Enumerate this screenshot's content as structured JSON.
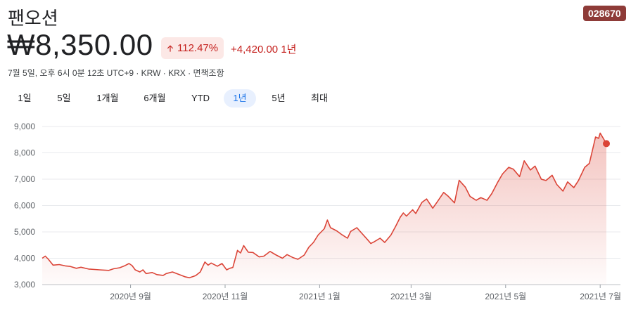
{
  "header": {
    "title": "팬오션",
    "ticker": "028670",
    "price": "₩8,350.00",
    "percent_change": "112.47%",
    "abs_change": "+4,420.00 1년",
    "meta": "7월 5일, 오후 6시 0분 12초 UTC+9 · KRW · KRX · 면책조항",
    "colors": {
      "negative_accent": "#c5221f",
      "badge_bg": "#fce8e6",
      "ticker_bg": "#8e3b38",
      "tab_active": "#1a73e8"
    },
    "icons": {
      "change_direction": "arrow-up-icon"
    }
  },
  "tabs": [
    {
      "label": "1일",
      "active": false
    },
    {
      "label": "5일",
      "active": false
    },
    {
      "label": "1개월",
      "active": false
    },
    {
      "label": "6개월",
      "active": false
    },
    {
      "label": "YTD",
      "active": false
    },
    {
      "label": "1년",
      "active": true
    },
    {
      "label": "5년",
      "active": false
    },
    {
      "label": "최대",
      "active": false
    }
  ],
  "chart_data": {
    "type": "area",
    "line_color": "#db4437",
    "grid": true,
    "ylim": [
      3000,
      9000
    ],
    "y_ticks": [
      {
        "value": 9000,
        "label": "9,000"
      },
      {
        "value": 8000,
        "label": "8,000"
      },
      {
        "value": 7000,
        "label": "7,000"
      },
      {
        "value": 6000,
        "label": "6,000"
      },
      {
        "value": 5000,
        "label": "5,000"
      },
      {
        "value": 4000,
        "label": "4,000"
      },
      {
        "value": 3000,
        "label": "3,000"
      }
    ],
    "xlim": [
      "2020-07-06",
      "2021-07-05"
    ],
    "x_ticks": [
      {
        "date": "2020-09-01",
        "label": "2020년 9월"
      },
      {
        "date": "2020-11-01",
        "label": "2020년 11월"
      },
      {
        "date": "2021-01-01",
        "label": "2021년 1월"
      },
      {
        "date": "2021-03-01",
        "label": "2021년 3월"
      },
      {
        "date": "2021-05-01",
        "label": "2021년 5월"
      },
      {
        "date": "2021-07-01",
        "label": "2021년 7월"
      }
    ],
    "series": [
      {
        "points": [
          [
            "2020-07-06",
            4000
          ],
          [
            "2020-07-08",
            4080
          ],
          [
            "2020-07-10",
            3960
          ],
          [
            "2020-07-13",
            3740
          ],
          [
            "2020-07-17",
            3760
          ],
          [
            "2020-07-21",
            3710
          ],
          [
            "2020-07-24",
            3690
          ],
          [
            "2020-07-28",
            3620
          ],
          [
            "2020-07-31",
            3660
          ],
          [
            "2020-08-05",
            3590
          ],
          [
            "2020-08-12",
            3560
          ],
          [
            "2020-08-18",
            3540
          ],
          [
            "2020-08-21",
            3600
          ],
          [
            "2020-08-25",
            3640
          ],
          [
            "2020-08-28",
            3710
          ],
          [
            "2020-08-31",
            3800
          ],
          [
            "2020-09-02",
            3720
          ],
          [
            "2020-09-04",
            3560
          ],
          [
            "2020-09-07",
            3480
          ],
          [
            "2020-09-09",
            3560
          ],
          [
            "2020-09-11",
            3420
          ],
          [
            "2020-09-15",
            3460
          ],
          [
            "2020-09-18",
            3380
          ],
          [
            "2020-09-22",
            3350
          ],
          [
            "2020-09-24",
            3420
          ],
          [
            "2020-09-28",
            3480
          ],
          [
            "2020-10-02",
            3390
          ],
          [
            "2020-10-06",
            3300
          ],
          [
            "2020-10-09",
            3260
          ],
          [
            "2020-10-13",
            3340
          ],
          [
            "2020-10-16",
            3480
          ],
          [
            "2020-10-19",
            3860
          ],
          [
            "2020-10-21",
            3740
          ],
          [
            "2020-10-23",
            3820
          ],
          [
            "2020-10-27",
            3700
          ],
          [
            "2020-10-30",
            3800
          ],
          [
            "2020-11-02",
            3560
          ],
          [
            "2020-11-04",
            3620
          ],
          [
            "2020-11-06",
            3650
          ],
          [
            "2020-11-09",
            4300
          ],
          [
            "2020-11-11",
            4200
          ],
          [
            "2020-11-13",
            4480
          ],
          [
            "2020-11-16",
            4230
          ],
          [
            "2020-11-19",
            4220
          ],
          [
            "2020-11-23",
            4050
          ],
          [
            "2020-11-26",
            4080
          ],
          [
            "2020-11-30",
            4260
          ],
          [
            "2020-12-04",
            4120
          ],
          [
            "2020-12-08",
            4000
          ],
          [
            "2020-12-11",
            4140
          ],
          [
            "2020-12-15",
            4020
          ],
          [
            "2020-12-18",
            3960
          ],
          [
            "2020-12-22",
            4120
          ],
          [
            "2020-12-25",
            4420
          ],
          [
            "2020-12-28",
            4600
          ],
          [
            "2020-12-31",
            4880
          ],
          [
            "2021-01-04",
            5120
          ],
          [
            "2021-01-06",
            5450
          ],
          [
            "2021-01-08",
            5160
          ],
          [
            "2021-01-12",
            5040
          ],
          [
            "2021-01-15",
            4910
          ],
          [
            "2021-01-19",
            4760
          ],
          [
            "2021-01-21",
            5020
          ],
          [
            "2021-01-25",
            5160
          ],
          [
            "2021-01-28",
            4960
          ],
          [
            "2021-02-01",
            4700
          ],
          [
            "2021-02-03",
            4560
          ],
          [
            "2021-02-05",
            4620
          ],
          [
            "2021-02-09",
            4760
          ],
          [
            "2021-02-12",
            4600
          ],
          [
            "2021-02-16",
            4880
          ],
          [
            "2021-02-19",
            5210
          ],
          [
            "2021-02-22",
            5560
          ],
          [
            "2021-02-24",
            5720
          ],
          [
            "2021-02-26",
            5600
          ],
          [
            "2021-03-02",
            5840
          ],
          [
            "2021-03-04",
            5700
          ],
          [
            "2021-03-08",
            6120
          ],
          [
            "2021-03-11",
            6250
          ],
          [
            "2021-03-15",
            5900
          ],
          [
            "2021-03-18",
            6150
          ],
          [
            "2021-03-22",
            6500
          ],
          [
            "2021-03-25",
            6350
          ],
          [
            "2021-03-29",
            6100
          ],
          [
            "2021-04-01",
            6960
          ],
          [
            "2021-04-05",
            6700
          ],
          [
            "2021-04-08",
            6350
          ],
          [
            "2021-04-12",
            6200
          ],
          [
            "2021-04-15",
            6300
          ],
          [
            "2021-04-19",
            6200
          ],
          [
            "2021-04-22",
            6450
          ],
          [
            "2021-04-26",
            6900
          ],
          [
            "2021-04-29",
            7200
          ],
          [
            "2021-05-03",
            7450
          ],
          [
            "2021-05-06",
            7380
          ],
          [
            "2021-05-10",
            7100
          ],
          [
            "2021-05-13",
            7700
          ],
          [
            "2021-05-17",
            7350
          ],
          [
            "2021-05-20",
            7500
          ],
          [
            "2021-05-24",
            7000
          ],
          [
            "2021-05-27",
            6950
          ],
          [
            "2021-05-31",
            7150
          ],
          [
            "2021-06-03",
            6800
          ],
          [
            "2021-06-07",
            6550
          ],
          [
            "2021-06-10",
            6900
          ],
          [
            "2021-06-14",
            6680
          ],
          [
            "2021-06-17",
            6950
          ],
          [
            "2021-06-21",
            7450
          ],
          [
            "2021-06-24",
            7600
          ],
          [
            "2021-06-28",
            8600
          ],
          [
            "2021-06-30",
            8550
          ],
          [
            "2021-07-01",
            8750
          ],
          [
            "2021-07-05",
            8350
          ]
        ]
      }
    ]
  }
}
